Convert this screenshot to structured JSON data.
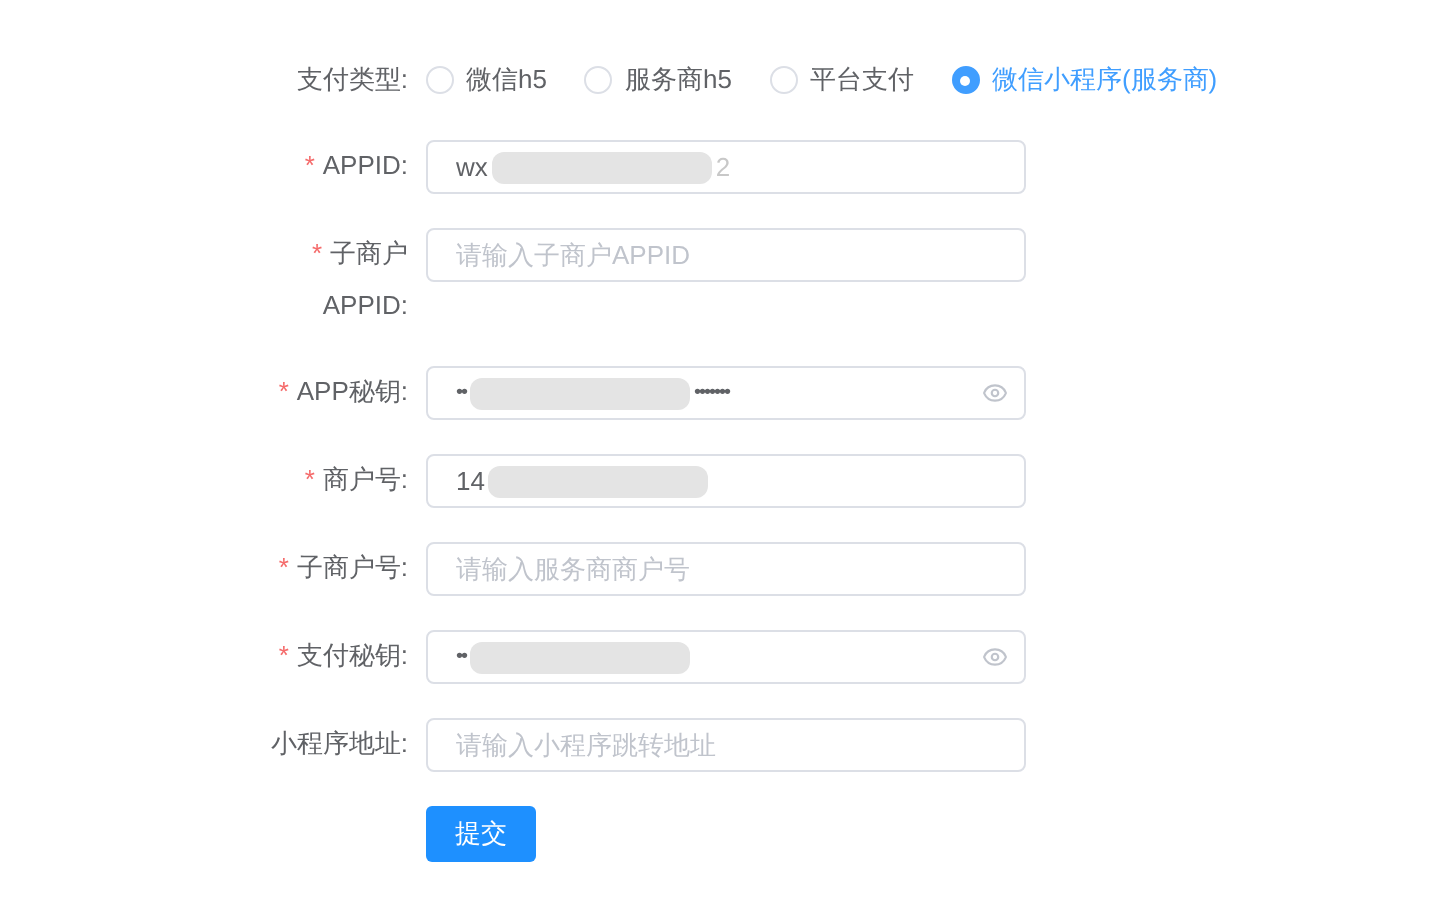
{
  "payment_type": {
    "label": "支付类型:",
    "options": [
      {
        "label": "微信h5",
        "selected": false
      },
      {
        "label": "服务商h5",
        "selected": false
      },
      {
        "label": "平台支付",
        "selected": false
      },
      {
        "label": "微信小程序(服务商)",
        "selected": true
      }
    ]
  },
  "fields": [
    {
      "required_mark": "*",
      "label": "APPID:",
      "value": "wx",
      "redacted": true,
      "value_end": "2"
    },
    {
      "required_mark": "*",
      "label": "子商户APPID:",
      "placeholder": "请输入子商户APPID"
    },
    {
      "required_mark": "*",
      "label": "APP秘钥:",
      "value": "••",
      "redacted": true,
      "value_end": "•••••••",
      "password": true
    },
    {
      "required_mark": "*",
      "label": "商户号:",
      "value": "14",
      "redacted": true
    },
    {
      "required_mark": "*",
      "label": "子商户号:",
      "placeholder": "请输入服务商商户号"
    },
    {
      "required_mark": "*",
      "label": "支付秘钥:",
      "value": "••",
      "redacted": true,
      "password": true
    },
    {
      "label": "小程序地址:",
      "placeholder": "请输入小程序跳转地址"
    }
  ],
  "submit": "提交"
}
